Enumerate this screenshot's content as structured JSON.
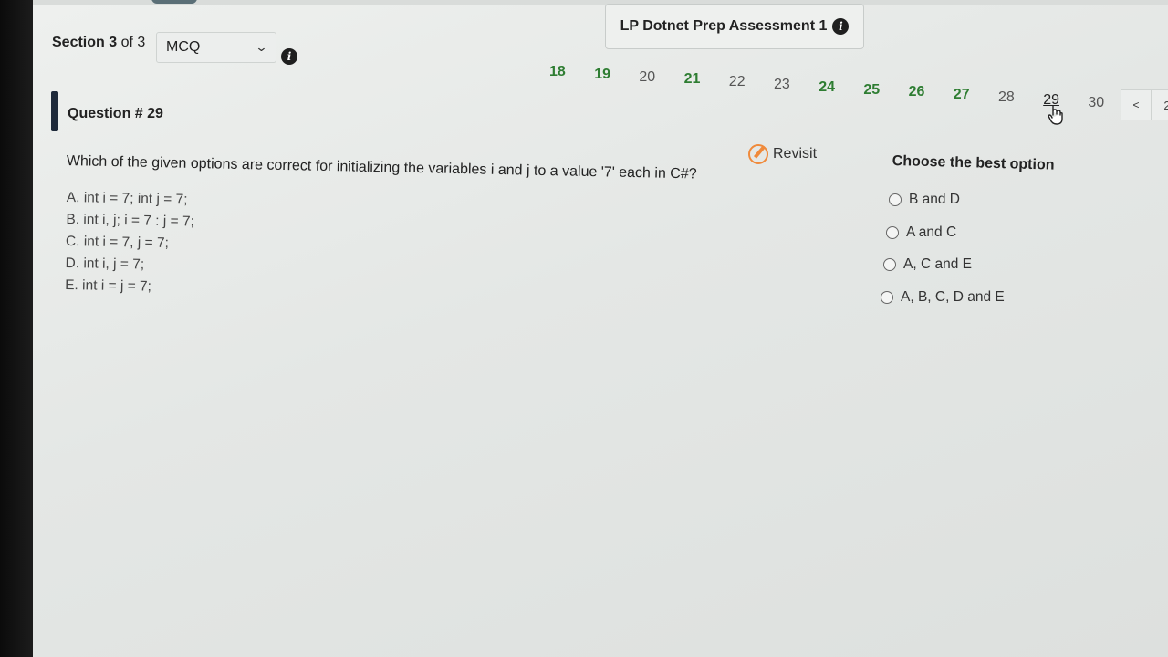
{
  "header": {
    "assessment_title": "LP Dotnet Prep Assessment 1",
    "info_icon": "info-icon"
  },
  "section": {
    "label_prefix": "Section",
    "current": "3",
    "of_text": "of 3",
    "type_selected": "MCQ",
    "info_icon": "info-icon"
  },
  "pager": {
    "pages": [
      {
        "num": "18",
        "state": "done"
      },
      {
        "num": "19",
        "state": "done"
      },
      {
        "num": "20",
        "state": "pending"
      },
      {
        "num": "21",
        "state": "done"
      },
      {
        "num": "22",
        "state": "pending"
      },
      {
        "num": "23",
        "state": "pending"
      },
      {
        "num": "24",
        "state": "done"
      },
      {
        "num": "25",
        "state": "done"
      },
      {
        "num": "26",
        "state": "done"
      },
      {
        "num": "27",
        "state": "done"
      },
      {
        "num": "28",
        "state": "pending"
      },
      {
        "num": "29",
        "state": "current"
      },
      {
        "num": "30",
        "state": "pending"
      }
    ],
    "prev_label": "<",
    "extra_box_label": "2"
  },
  "question": {
    "title": "Question # 29",
    "text": "Which of the given options are correct for initializing the variables i and j to a value '7' each in C#?",
    "options": [
      "A. int i = 7; int j = 7;",
      "B. int i, j; i = 7 : j = 7;",
      "C. int i = 7, j = 7;",
      "D. int i, j = 7;",
      "E. int i = j = 7;"
    ]
  },
  "revisit": {
    "label": "Revisit",
    "icon": "revisit-icon",
    "color": "#f08a3b"
  },
  "answers": {
    "heading": "Choose the best option",
    "choices": [
      "B and D",
      "A and C",
      "A, C and E",
      "A, B, C, D and E"
    ],
    "selected": null
  },
  "colors": {
    "done": "#2e7d32",
    "background": "#e8ebe9",
    "marker": "#1e2a3a"
  }
}
